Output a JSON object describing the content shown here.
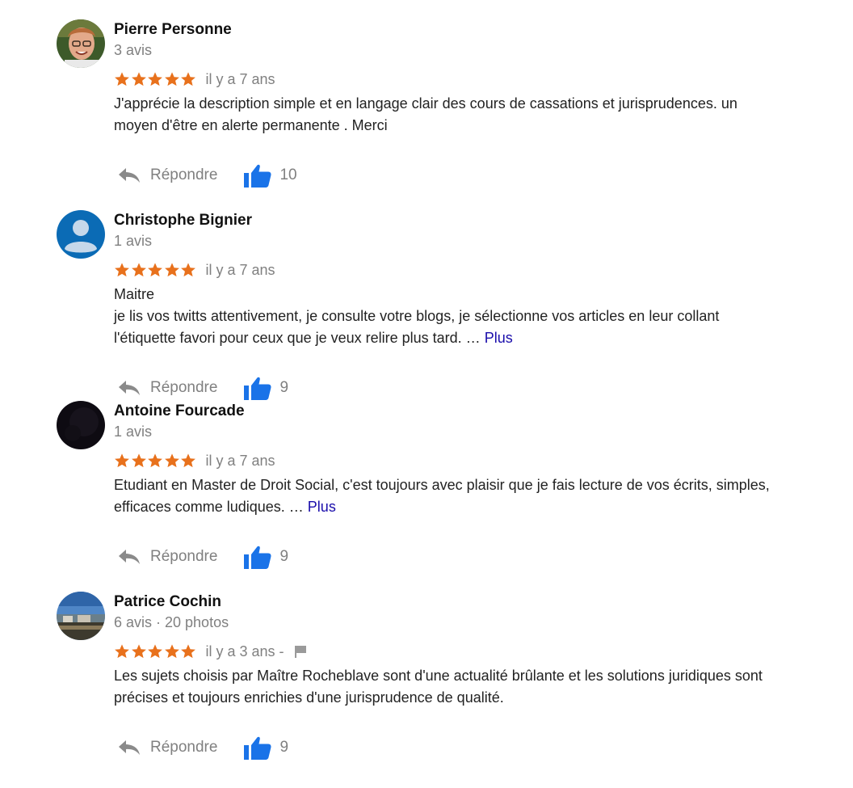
{
  "colors": {
    "star": "#e8711c",
    "thumb": "#1a73e8",
    "link": "#1a0dab",
    "muted": "#808080"
  },
  "icons": {
    "star": "star-icon",
    "reply": "reply-arrow-icon",
    "like": "thumbs-up-icon",
    "flag": "flag-icon"
  },
  "reviews": [
    {
      "name": "Pierre Personne",
      "meta": "3 avis",
      "rating": 5,
      "date": "il y a 7 ans",
      "lines": [
        "J'apprécie la description simple et en langage clair des cours de cassations et jurisprudences. un",
        "moyen d'être en alerte permanente . Merci"
      ],
      "more": "",
      "reply_label": "Répondre",
      "likes": "10",
      "avatar": "photo-man-glasses"
    },
    {
      "name": "Christophe Bignier",
      "meta": "1 avis",
      "rating": 5,
      "date": "il y a 7 ans",
      "lines": [
        "Maitre",
        "je lis vos twitts attentivement, je consulte votre blogs, je sélectionne vos articles en leur collant",
        "l'étiquette favori pour ceux que je veux relire plus tard. …"
      ],
      "more": "Plus",
      "reply_label": "Répondre",
      "likes": "9",
      "avatar": "default-person"
    },
    {
      "name": "Antoine Fourcade",
      "meta": "1 avis",
      "rating": 5,
      "date": "il y a 7 ans",
      "lines": [
        "Etudiant en Master de Droit Social, c'est toujours avec plaisir que je fais lecture de vos écrits, simples,",
        "efficaces comme ludiques. …"
      ],
      "more": "Plus",
      "reply_label": "Répondre",
      "likes": "9",
      "avatar": "dark-photo"
    },
    {
      "name": "Patrice Cochin",
      "meta": "6 avis · 20 photos",
      "rating": 5,
      "date": "il y a 3 ans -",
      "flag": true,
      "lines": [
        "Les sujets choisis par Maître Rocheblave sont d'une actualité brûlante et les solutions juridiques sont",
        "précises et toujours enrichies d'une jurisprudence de qualité."
      ],
      "more": "",
      "reply_label": "Répondre",
      "likes": "9",
      "avatar": "landscape-photo"
    }
  ]
}
